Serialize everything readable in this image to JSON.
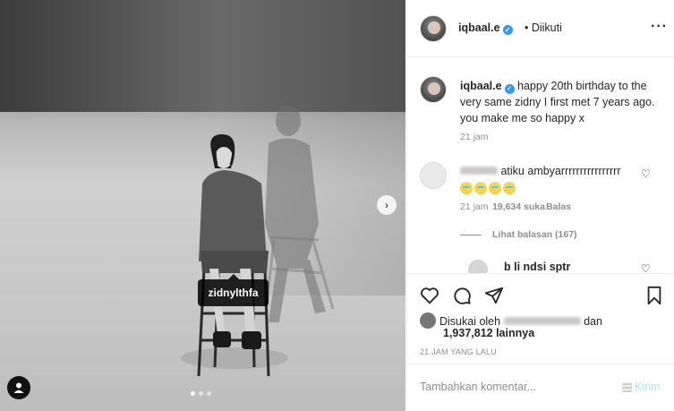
{
  "post": {
    "author": "iqbaal.e",
    "follow_status": "• Diikuti",
    "more_icon": "more-dots-icon",
    "photo_tag": "zidnylthfa",
    "carousel": {
      "count": 3,
      "active": 1
    },
    "caption": "happy 20th birthday to the very same zidny I first met 7 years ago. you make me so happy x",
    "caption_time": "21 jam"
  },
  "comments": [
    {
      "text": "atiku ambyarrrrrrrrrrrrrrrr",
      "emoji_count": 4,
      "time": "21 jam",
      "likes": "19,634 suka",
      "reply_label": "Balas",
      "view_replies": "Lihat balasan (167)"
    }
  ],
  "reply_preview": {
    "partial_name": "b      li  ndsi  sptr"
  },
  "actions": {
    "like_icon": "heart-icon",
    "comment_icon": "comment-icon",
    "share_icon": "share-icon",
    "save_icon": "bookmark-icon"
  },
  "likes": {
    "prefix": "Disukai oleh",
    "conjunction": "dan",
    "count": "1,937,812 lainnya"
  },
  "timestamp": "21 JAM YANG LALU",
  "comment_form": {
    "placeholder": "Tambahkan komentar...",
    "post_label": "Kirim"
  }
}
